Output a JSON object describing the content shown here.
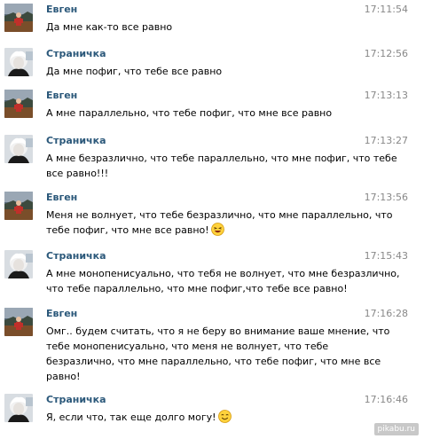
{
  "messages": [
    {
      "author": "Евген",
      "time": "17:11:54",
      "lines": [
        "Да мне как-то все равно"
      ],
      "emoji": ""
    },
    {
      "author": "Страничка",
      "time": "17:12:56",
      "lines": [
        "Да мне пофиг, что тебе все равно"
      ],
      "emoji": ""
    },
    {
      "author": "Евген",
      "time": "17:13:13",
      "lines": [
        "А мне параллельно, что тебе пофиг, что мне все равно"
      ],
      "emoji": ""
    },
    {
      "author": "Страничка",
      "time": "17:13:27",
      "lines": [
        "А мне безразлично, что тебе параллельно, что мне пофиг, что тебе",
        "все равно!!!"
      ],
      "emoji": ""
    },
    {
      "author": "Евген",
      "time": "17:13:56",
      "lines": [
        "Меня не волнует, что тебе безразлично, что мне параллельно, что",
        "тебе пофиг, что мне все равно!"
      ],
      "emoji": "laughing-emoji"
    },
    {
      "author": "Страничка",
      "time": "17:15:43",
      "lines": [
        "А мне монопенисуально, что тебя не волнует, что мне безразлично,",
        "что тебе параллельно, что мне пофиг,что тебе все равно!"
      ],
      "emoji": ""
    },
    {
      "author": "Евген",
      "time": "17:16:28",
      "lines": [
        "Омг.. будем считать, что я не беру во внимание ваше мнение, что",
        "тебе монопенисуально, что меня не волнует, что тебе",
        "безразлично, что мне параллельно, что тебе пофиг, что мне все",
        "равно!"
      ],
      "emoji": ""
    },
    {
      "author": "Страничка",
      "time": "17:16:46",
      "lines": [
        "Я, если что, так еще долго могу!"
      ],
      "emoji": "smiling-emoji"
    }
  ],
  "watermark": "pikabu.ru",
  "colors": {
    "author": "#2b587a",
    "time": "#888888",
    "text": "#000000"
  }
}
